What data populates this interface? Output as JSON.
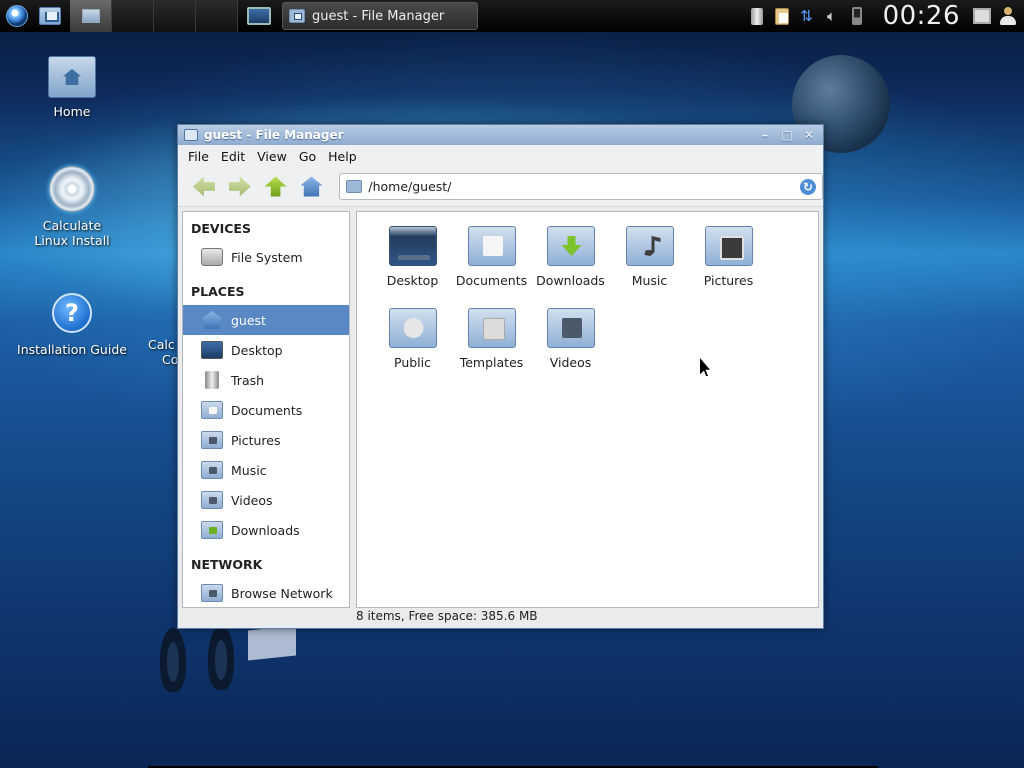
{
  "panel": {
    "taskbar_title": "guest - File Manager",
    "clock": "00:26",
    "icons": [
      "calculate-menu-icon",
      "home-launcher-icon",
      "file-manager-launcher-icon",
      "show-desktop-icon",
      "trash-tray-icon",
      "clipboard-icon",
      "network-icon",
      "volume-icon",
      "battery-icon",
      "screen-icon",
      "user-icon"
    ]
  },
  "desktop": {
    "icons": [
      {
        "label": "Home",
        "icon": "home-folder-icon"
      },
      {
        "label": "Calculate Linux Install",
        "icon": "install-disc-icon"
      },
      {
        "label": "Installation Guide",
        "icon": "help-icon"
      },
      {
        "label": "Calc",
        "label2": "Co",
        "icon": "partial-icon"
      }
    ]
  },
  "window": {
    "title": "guest - File Manager",
    "controls": {
      "minimize": "–",
      "maximize": "□",
      "close": "✕"
    },
    "menu": [
      "File",
      "Edit",
      "View",
      "Go",
      "Help"
    ],
    "location": "/home/guest/",
    "sidebar": {
      "devices_header": "DEVICES",
      "devices": [
        {
          "label": "File System",
          "icon": "harddisk-icon"
        }
      ],
      "places_header": "PLACES",
      "places": [
        {
          "label": "guest",
          "icon": "home-icon",
          "selected": true
        },
        {
          "label": "Desktop",
          "icon": "desktop-icon"
        },
        {
          "label": "Trash",
          "icon": "trash-icon"
        },
        {
          "label": "Documents",
          "icon": "documents-folder-icon"
        },
        {
          "label": "Pictures",
          "icon": "pictures-folder-icon"
        },
        {
          "label": "Music",
          "icon": "music-folder-icon"
        },
        {
          "label": "Videos",
          "icon": "videos-folder-icon"
        },
        {
          "label": "Downloads",
          "icon": "downloads-folder-icon"
        }
      ],
      "network_header": "NETWORK",
      "network": [
        {
          "label": "Browse Network",
          "icon": "network-folder-icon"
        }
      ]
    },
    "files": [
      {
        "label": "Desktop",
        "icon": "desktop-folder-icon"
      },
      {
        "label": "Documents",
        "icon": "documents-folder-icon"
      },
      {
        "label": "Downloads",
        "icon": "downloads-folder-icon"
      },
      {
        "label": "Music",
        "icon": "music-folder-icon"
      },
      {
        "label": "Pictures",
        "icon": "pictures-folder-icon"
      },
      {
        "label": "Public",
        "icon": "public-folder-icon"
      },
      {
        "label": "Templates",
        "icon": "templates-folder-icon"
      },
      {
        "label": "Videos",
        "icon": "videos-folder-icon"
      }
    ],
    "status": "8 items, Free space: 385.6 MB"
  }
}
